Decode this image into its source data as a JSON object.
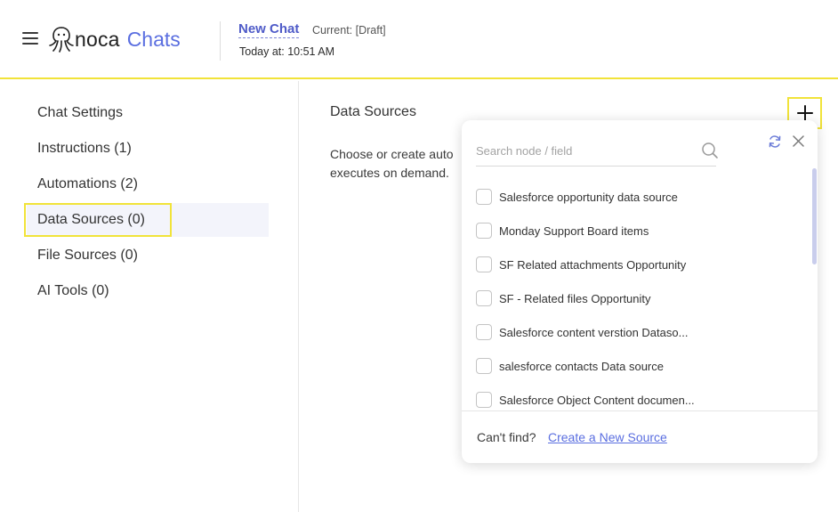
{
  "header": {
    "logo_text": "noca",
    "logo_accent": "Chats",
    "chat_title": "New Chat",
    "chat_status": "Current: [Draft]",
    "chat_time": "Today at: 10:51 AM"
  },
  "sidebar": {
    "items": [
      {
        "label": "Chat Settings"
      },
      {
        "label": "Instructions (1)"
      },
      {
        "label": "Automations (2)"
      },
      {
        "label": "Data Sources (0)"
      },
      {
        "label": "File Sources (0)"
      },
      {
        "label": "AI Tools (0)"
      }
    ],
    "active_index": 3
  },
  "main": {
    "title": "Data Sources",
    "description_line1": "Choose or create auto",
    "description_line2": "executes on demand."
  },
  "popup": {
    "search_placeholder": "Search node / field",
    "items": [
      {
        "label": "Salesforce opportunity data source"
      },
      {
        "label": "Monday Support Board items"
      },
      {
        "label": "SF Related attachments Opportunity"
      },
      {
        "label": "SF - Related files Opportunity"
      },
      {
        "label": "Salesforce content verstion  Dataso..."
      },
      {
        "label": "salesforce contacts Data source"
      },
      {
        "label": "Salesforce Object Content documen..."
      }
    ],
    "footer_text": "Can't find?",
    "footer_link": "Create a New Source"
  },
  "colors": {
    "accent": "#5a6ee0",
    "highlight": "#f1e33a",
    "title_link": "#4f5bc8"
  },
  "icons": {
    "menu": "hamburger-icon",
    "add": "plus-icon",
    "search": "search-icon",
    "refresh": "refresh-icon",
    "close": "close-icon"
  }
}
